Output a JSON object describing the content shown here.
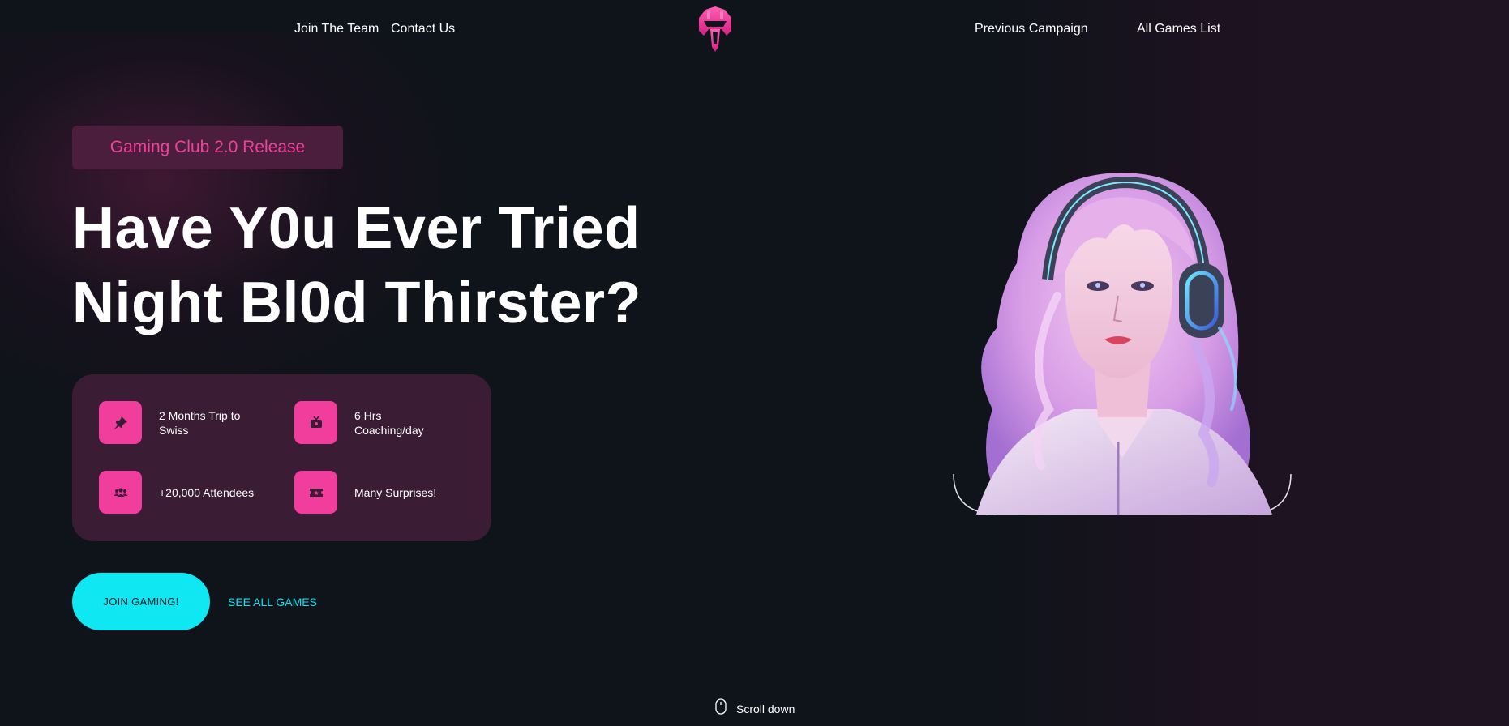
{
  "nav": {
    "left_links": [
      "Join The Team",
      "Contact Us"
    ],
    "right_links": [
      "Previous Campaign",
      "All Games List"
    ],
    "logo_icon": "helmet-logo-icon"
  },
  "hero": {
    "badge": "Gaming Club 2.0 Release",
    "headline_line1": "Have Y0u Ever Tried",
    "headline_line2": "Night Bl0d Thirster?",
    "features": [
      {
        "icon": "pin-icon",
        "text": "2 Months Trip to Swiss"
      },
      {
        "icon": "tv-icon",
        "text": "6 Hrs Coaching/day"
      },
      {
        "icon": "users-icon",
        "text": "+20,000 Attendees"
      },
      {
        "icon": "ticket-icon",
        "text": "Many Surprises!"
      }
    ],
    "primary_button": "JOIN GAMING!",
    "secondary_link": "SEE ALL GAMES",
    "image_icon": "gamer-girl-headphones-illustration"
  },
  "scroll": {
    "label": "Scroll down",
    "icon": "mouse-icon"
  },
  "colors": {
    "background": "#0f131a",
    "accent_pink": "#f13d9b",
    "accent_cyan": "#0fe7f2",
    "card": "#3a1c34",
    "badge": "#4a1e3c"
  }
}
